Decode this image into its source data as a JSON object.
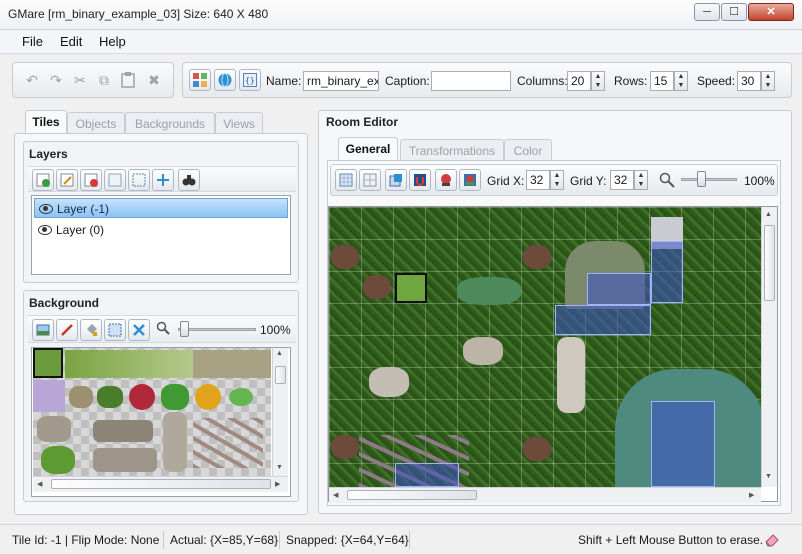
{
  "window": {
    "title": "GMare [rm_binary_example_03] Size: 640 X 480",
    "minimize": "─",
    "maximize": "☐",
    "close": "✕"
  },
  "menu": {
    "items": [
      "File",
      "Edit",
      "Help"
    ]
  },
  "toolbar": {
    "name_label": "Name:",
    "name_value": "rm_binary_exar",
    "caption_label": "Caption:",
    "caption_value": "",
    "columns_label": "Columns:",
    "columns_value": "20",
    "rows_label": "Rows:",
    "rows_value": "15",
    "speed_label": "Speed:",
    "speed_value": "30"
  },
  "left_tabs": [
    "Tiles",
    "Objects",
    "Backgrounds",
    "Views"
  ],
  "layers": {
    "title": "Layers",
    "items": [
      "Layer (-1)",
      "Layer (0)"
    ]
  },
  "background": {
    "title": "Background",
    "zoom": "100%"
  },
  "room_editor": {
    "title": "Room Editor",
    "tabs": [
      "General",
      "Transformations",
      "Color"
    ],
    "grid_x_label": "Grid X:",
    "grid_x_value": "32",
    "grid_y_label": "Grid Y:",
    "grid_y_value": "32",
    "zoom": "100%"
  },
  "status": {
    "tile_info": "Tile Id: -1 | Flip Mode: None",
    "actual": "Actual: {X=85,Y=68}",
    "snapped": "Snapped: {X=64,Y=64}",
    "hint": "Shift + Left Mouse Button to erase."
  },
  "icons": {
    "undo": "↶",
    "redo": "↷",
    "cut": "✂",
    "copy": "⧉",
    "paste": "📋",
    "delete": "✖",
    "eye": "eye-icon",
    "zoom": "🔍",
    "binoculars": "🔭"
  },
  "colors": {
    "accent": "#8cc3f3",
    "grass": "#3a6a24",
    "water": "#3a4fb0"
  }
}
